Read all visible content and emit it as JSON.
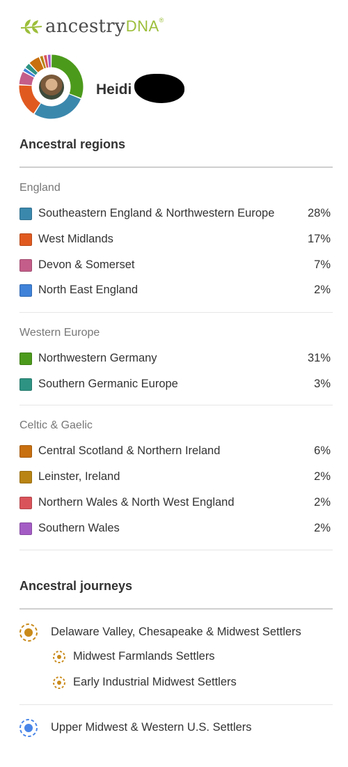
{
  "logo": {
    "word": "ancestry",
    "dna": "DNA",
    "tm": "®"
  },
  "profile": {
    "name": "Heidi"
  },
  "ancestral_regions": {
    "title": "Ancestral regions",
    "groups": [
      {
        "name": "England",
        "regions": [
          {
            "label": "Southeastern England & Northwestern Europe",
            "percent": "28%",
            "color": "#3b88ad"
          },
          {
            "label": "West Midlands",
            "percent": "17%",
            "color": "#e05a20"
          },
          {
            "label": "Devon & Somerset",
            "percent": "7%",
            "color": "#c45d89"
          },
          {
            "label": "North East England",
            "percent": "2%",
            "color": "#3f82d9"
          }
        ]
      },
      {
        "name": "Western Europe",
        "regions": [
          {
            "label": "Northwestern Germany",
            "percent": "31%",
            "color": "#4c9a1c"
          },
          {
            "label": "Southern Germanic Europe",
            "percent": "3%",
            "color": "#2e9383"
          }
        ]
      },
      {
        "name": "Celtic & Gaelic",
        "regions": [
          {
            "label": "Central Scotland & Northern Ireland",
            "percent": "6%",
            "color": "#c86f0f"
          },
          {
            "label": "Leinster, Ireland",
            "percent": "2%",
            "color": "#b98413"
          },
          {
            "label": "Northern Wales & North West England",
            "percent": "2%",
            "color": "#d9545a"
          },
          {
            "label": "Southern Wales",
            "percent": "2%",
            "color": "#a45cc5"
          }
        ]
      }
    ]
  },
  "ancestral_journeys": {
    "title": "Ancestral journeys",
    "items": [
      {
        "label": "Delaware Valley, Chesapeake & Midwest Settlers",
        "color": "#c98a1a",
        "level": 0
      },
      {
        "label": "Midwest Farmlands Settlers",
        "color": "#c98a1a",
        "level": 1
      },
      {
        "label": "Early Industrial Midwest Settlers",
        "color": "#c98a1a",
        "level": 1
      },
      {
        "label": "Upper Midwest & Western U.S. Settlers",
        "color": "#4a86e8",
        "level": 0
      }
    ]
  }
}
